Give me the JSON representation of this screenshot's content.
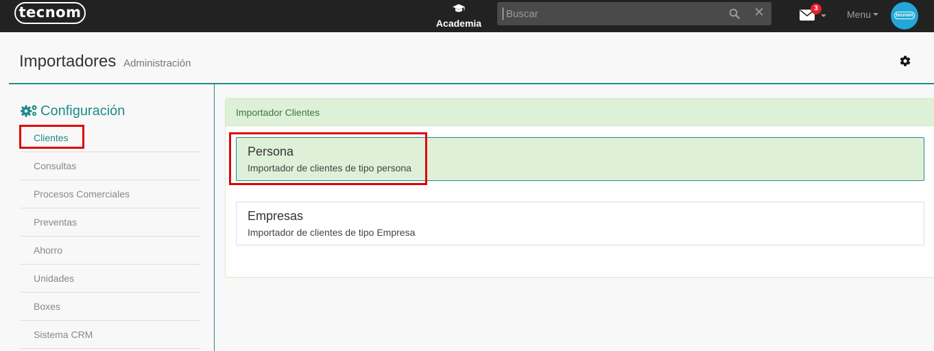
{
  "navbar": {
    "logo_text": "tecnom",
    "academia_label": "Academia",
    "search_placeholder": "Buscar",
    "mail_badge": "3",
    "menu_label": "Menu",
    "avatar_text": "tecnom"
  },
  "header": {
    "title": "Importadores",
    "subtitle": "Administración"
  },
  "sidebar": {
    "title": "Configuración",
    "items": [
      {
        "label": "Clientes",
        "active": true
      },
      {
        "label": "Consultas"
      },
      {
        "label": "Procesos Comerciales"
      },
      {
        "label": "Preventas"
      },
      {
        "label": "Ahorro"
      },
      {
        "label": "Unidades"
      },
      {
        "label": "Boxes"
      },
      {
        "label": "Sistema CRM"
      }
    ]
  },
  "panel": {
    "heading": "Importador Clientes",
    "cards": [
      {
        "title": "Persona",
        "description": "Importador de clientes de tipo persona",
        "selected": true
      },
      {
        "title": "Empresas",
        "description": "Importador de clientes de tipo Empresa",
        "selected": false
      }
    ]
  },
  "colors": {
    "navbar_bg": "#222222",
    "accent": "#1e8a8a",
    "success_bg": "#dff0d8",
    "highlight": "#e00000",
    "badge": "#e8202a"
  },
  "icons": [
    "graduation-cap-icon",
    "search-icon",
    "close-icon",
    "envelope-icon",
    "chevron-down-icon",
    "gear-icon",
    "gears-icon"
  ]
}
